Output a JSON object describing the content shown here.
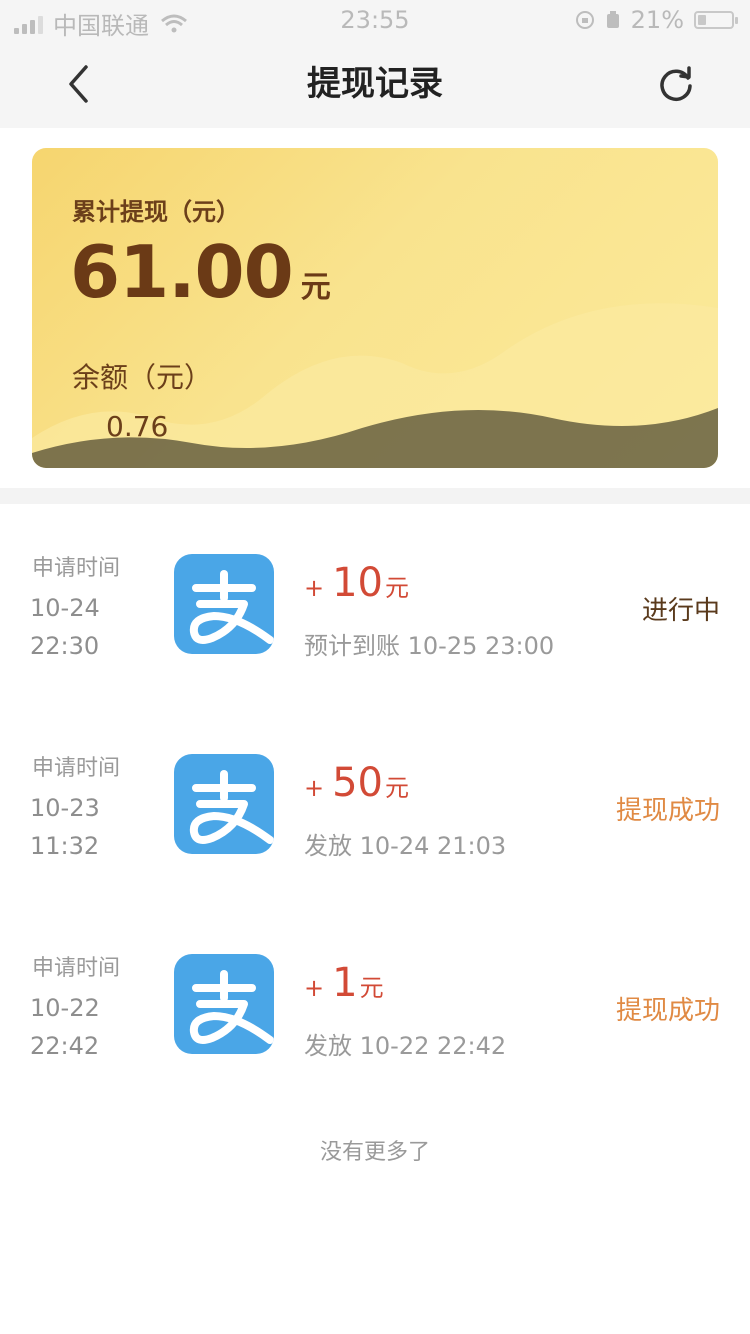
{
  "status_bar": {
    "carrier": "中国联通",
    "time": "23:55",
    "battery": "21%"
  },
  "nav": {
    "title": "提现记录",
    "back_icon": "chevron-left-icon",
    "refresh_icon": "refresh-icon"
  },
  "summary": {
    "total_label": "累计提现（元）",
    "total_value": "61.00",
    "total_unit": "元",
    "balance_label": "余额（元）",
    "balance_value": "0.76"
  },
  "records": [
    {
      "time_label": "申请时间",
      "date": "10-24",
      "clock": "22:30",
      "plus": "+",
      "amount": "10",
      "unit": "元",
      "sub": "预计到账 10-25 23:00",
      "status": "进行中",
      "status_color": "#5a3a1c"
    },
    {
      "time_label": "申请时间",
      "date": "10-23",
      "clock": "11:32",
      "plus": "+",
      "amount": "50",
      "unit": "元",
      "sub": "发放 10-24 21:03",
      "status": "提现成功",
      "status_color": "#e08a44"
    },
    {
      "time_label": "申请时间",
      "date": "10-22",
      "clock": "22:42",
      "plus": "+",
      "amount": "1",
      "unit": "元",
      "sub": "发放 10-22 22:42",
      "status": "提现成功",
      "status_color": "#e08a44"
    }
  ],
  "footer": {
    "no_more": "没有更多了"
  },
  "colors": {
    "accent_red": "#d24a36",
    "success_orange": "#e08a44",
    "alipay_blue": "#4aa6e7"
  }
}
